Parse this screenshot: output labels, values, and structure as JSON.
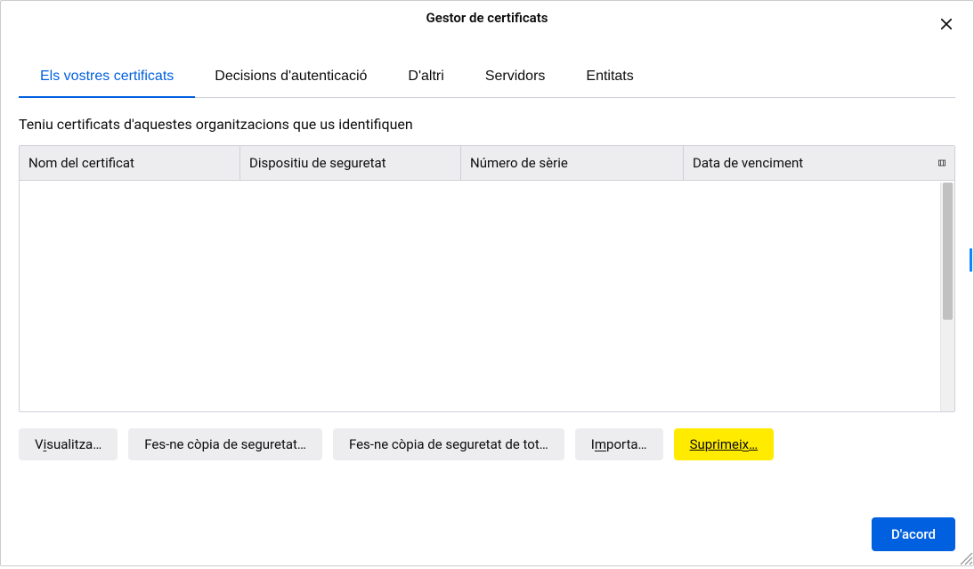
{
  "header": {
    "title": "Gestor de certificats"
  },
  "tabs": {
    "your_certs": "Els vostres certificats",
    "auth_decisions": "Decisions d'autenticació",
    "people": "D'altri",
    "servers": "Servidors",
    "authorities": "Entitats"
  },
  "description": "Teniu certificats d'aquestes organitzacions que us identifiquen",
  "columns": {
    "name": "Nom del certificat",
    "device": "Dispositiu de seguretat",
    "serial": "Número de sèrie",
    "expiry": "Data de venciment"
  },
  "rows": [],
  "buttons": {
    "view_pre": "V",
    "view_u": "i",
    "view_post": "sualitza…",
    "backup": "Fes-ne còpia de seguretat…",
    "backup_all": "Fes-ne còpia de seguretat de tot…",
    "import_pre": "I",
    "import_u": "m",
    "import_post": "porta…",
    "delete_pre": "Suprimei",
    "delete_u": "x",
    "delete_post": "…"
  },
  "footer": {
    "ok": "D'acord"
  }
}
